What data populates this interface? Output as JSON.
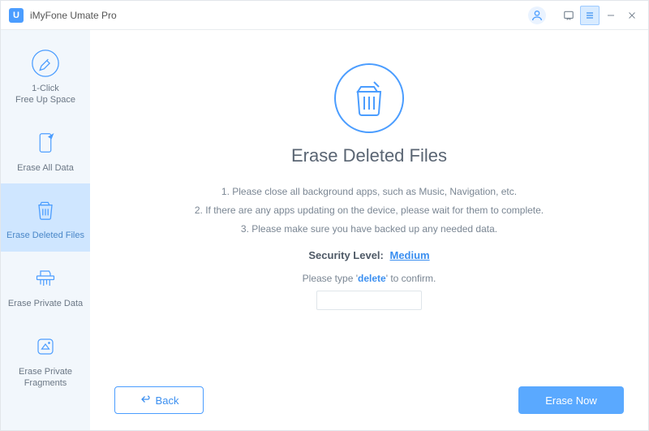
{
  "app": {
    "title": "iMyFone Umate Pro",
    "logo_letter": "U"
  },
  "sidebar": {
    "items": [
      {
        "label": "1-Click\nFree Up Space"
      },
      {
        "label": "Erase All Data"
      },
      {
        "label": "Erase Deleted Files"
      },
      {
        "label": "Erase Private Data"
      },
      {
        "label": "Erase Private\nFragments"
      }
    ]
  },
  "main": {
    "title": "Erase Deleted Files",
    "instructions": [
      "1. Please close all background apps, such as Music, Navigation, etc.",
      "2. If there are any apps updating on the device, please wait for them to complete.",
      "3. Please make sure you have backed up any needed data."
    ],
    "security_label": "Security Level:",
    "security_value": "Medium",
    "confirm_prefix": "Please type '",
    "confirm_word": "delete",
    "confirm_suffix": "' to confirm.",
    "confirm_value": ""
  },
  "footer": {
    "back": "Back",
    "erase": "Erase Now"
  }
}
